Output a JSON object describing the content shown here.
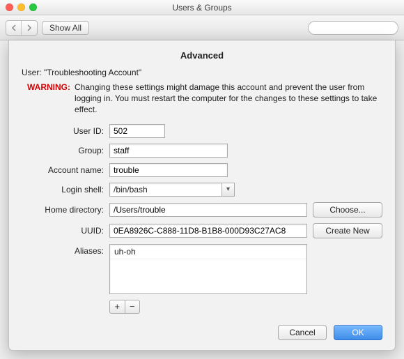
{
  "window": {
    "title": "Users & Groups",
    "toolbar": {
      "show_all": "Show All",
      "search_placeholder": ""
    }
  },
  "sheet": {
    "heading": "Advanced",
    "user_prefix": "User: ",
    "user_name": "\"Troubleshooting Account\"",
    "warning_label": "WARNING:",
    "warning_text": "Changing these settings might damage this account and prevent the user from logging in. You must restart the computer for the changes to these settings to take effect.",
    "labels": {
      "user_id": "User ID:",
      "group": "Group:",
      "account_name": "Account name:",
      "login_shell": "Login shell:",
      "home_dir": "Home directory:",
      "uuid": "UUID:",
      "aliases": "Aliases:"
    },
    "values": {
      "user_id": "502",
      "group": "staff",
      "account_name": "trouble",
      "login_shell": "/bin/bash",
      "home_dir": "/Users/trouble",
      "uuid": "0EA8926C-C888-11D8-B1B8-000D93C27AC8",
      "aliases": [
        "uh-oh"
      ]
    },
    "buttons": {
      "choose": "Choose...",
      "create_new": "Create New",
      "plus": "+",
      "minus": "−",
      "cancel": "Cancel",
      "ok": "OK"
    }
  }
}
